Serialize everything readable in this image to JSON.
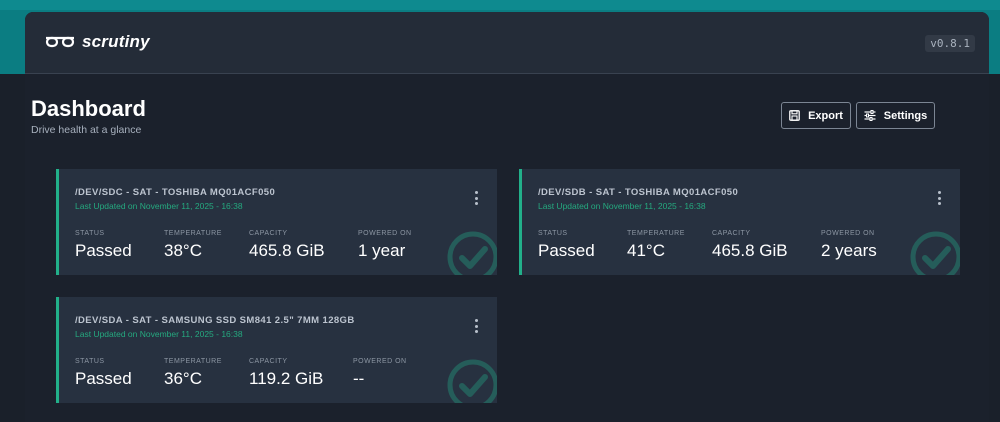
{
  "app": {
    "name": "scrutiny",
    "version": "v0.8.1"
  },
  "header": {
    "title": "Dashboard",
    "subtitle": "Drive health at a glance",
    "export_label": "Export",
    "settings_label": "Settings"
  },
  "colors": {
    "teal_band": "#0b7d82",
    "accent_green": "#22b08a",
    "card_bg": "#273140"
  },
  "labels": {
    "status": "STATUS",
    "temperature": "TEMPERATURE",
    "capacity": "CAPACITY",
    "powered_on": "POWERED ON"
  },
  "drives": [
    {
      "title": "/DEV/SDC - SAT - TOSHIBA MQ01ACF050",
      "updated": "Last Updated on November 11, 2025 - 16:38",
      "status": "Passed",
      "temperature": "38°C",
      "capacity": "465.8 GiB",
      "powered_on": "1 year"
    },
    {
      "title": "/DEV/SDB - SAT - TOSHIBA MQ01ACF050",
      "updated": "Last Updated on November 11, 2025 - 16:38",
      "status": "Passed",
      "temperature": "41°C",
      "capacity": "465.8 GiB",
      "powered_on": "2 years"
    },
    {
      "title": "/DEV/SDA - SAT - SAMSUNG SSD SM841 2.5\" 7MM 128GB",
      "updated": "Last Updated on November 11, 2025 - 16:38",
      "status": "Passed",
      "temperature": "36°C",
      "capacity": "119.2 GiB",
      "powered_on": "--"
    }
  ]
}
